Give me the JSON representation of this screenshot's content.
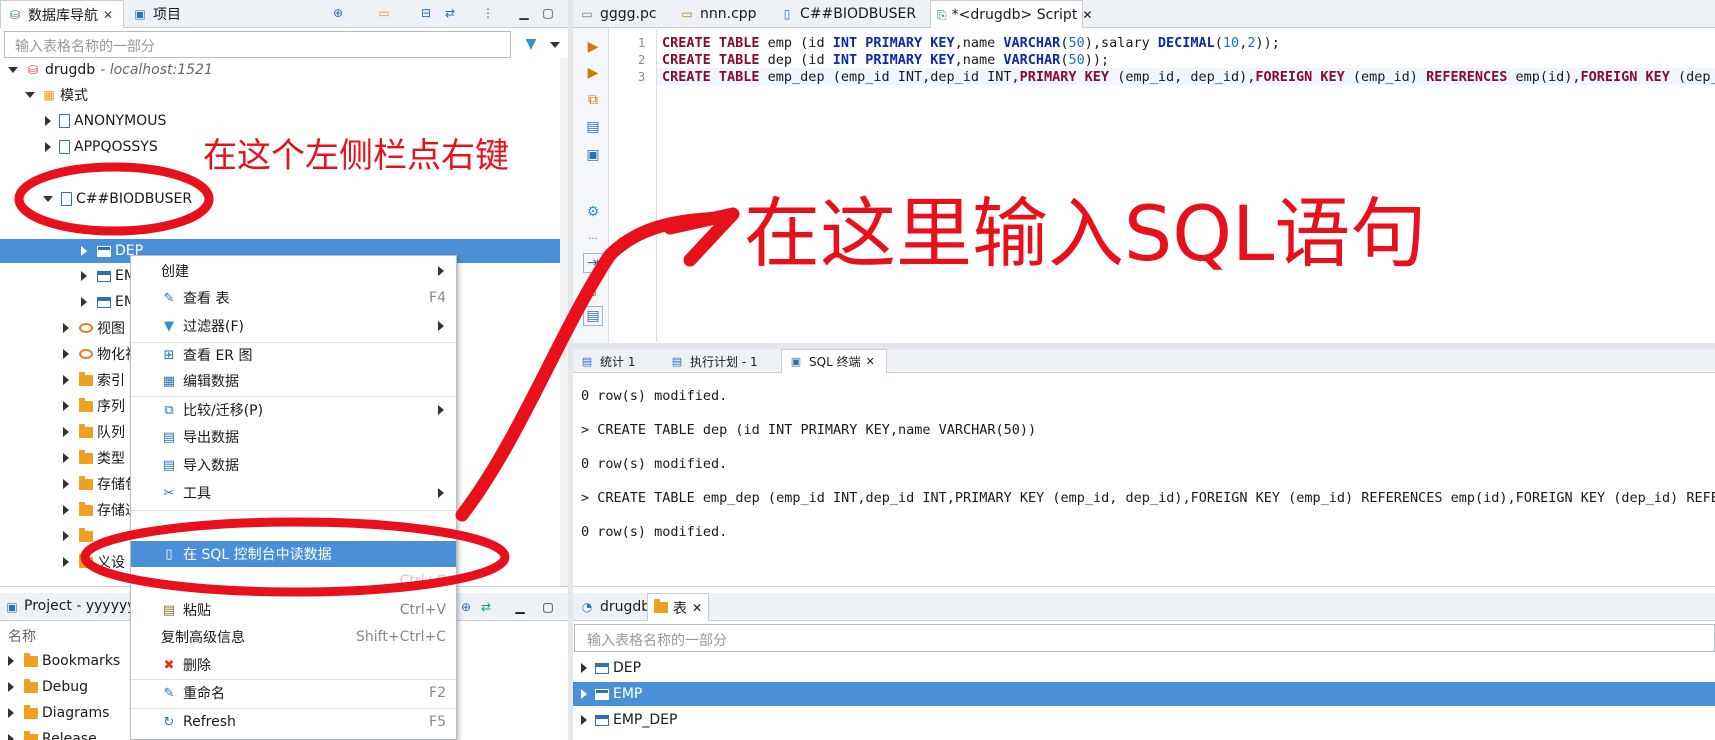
{
  "left_panel": {
    "tabs": [
      {
        "label": "数据库导航"
      },
      {
        "label": "项目"
      }
    ],
    "search_placeholder": "输入表格名称的一部分",
    "connection": {
      "name": "drugdb",
      "host": "- localhost:1521"
    },
    "schemas_node": "模式",
    "tree": {
      "schema1": "ANONYMOUS",
      "schema2": "APPQOSSYS",
      "schema3": "C##BIODBUSER",
      "table1": "DEP",
      "table2": "EMP",
      "table3": "EMP",
      "views": "视图",
      "mviews": "物化视",
      "indexes": "索引",
      "sequences": "序列",
      "queues": "队列",
      "types": "类型",
      "procs1": "存储包",
      "procs2": "存储过",
      "last1": "",
      "last2": "义设"
    }
  },
  "context_menu": {
    "items": {
      "create": "创建",
      "view_table": "查看 表",
      "view_table_sc": "F4",
      "filter": "过滤器(F)",
      "view_er": "查看 ER 图",
      "edit_data": "编辑数据",
      "compare": "比较/迁移(P)",
      "export": "导出数据",
      "import": "导入数据",
      "tools": "工具",
      "read_sql": "在 SQL 控制台中读数据",
      "hidden_sc": "Ctrl+C",
      "paste": "粘贴",
      "paste_sc": "Ctrl+V",
      "copy_adv": "复制高级信息",
      "copy_adv_sc": "Shift+Ctrl+C",
      "delete": "删除",
      "rename": "重命名",
      "rename_sc": "F2",
      "refresh": "Refresh",
      "refresh_sc": "F5"
    }
  },
  "project_panel": {
    "title": "Project - yyyyyyy",
    "col_name": "名称",
    "items": [
      "Bookmarks",
      "Debug",
      "Diagrams",
      "Release"
    ]
  },
  "editor": {
    "tabs": [
      {
        "label": "gggg.pc"
      },
      {
        "label": "nnn.cpp"
      },
      {
        "label": "C##BIODBUSER"
      },
      {
        "label": "*<drugdb> Script"
      }
    ],
    "lines": [
      [
        [
          "kw",
          "CREATE TABLE "
        ],
        [
          "",
          "emp (id "
        ],
        [
          "ty",
          "INT PRIMARY KEY"
        ],
        [
          "",
          ",name "
        ],
        [
          "ty",
          "VARCHAR"
        ],
        [
          "",
          "("
        ],
        [
          "nm",
          "50"
        ],
        [
          "",
          "),salary "
        ],
        [
          "ty",
          "DECIMAL"
        ],
        [
          "",
          "("
        ],
        [
          "nm",
          "10"
        ],
        [
          "",
          ","
        ],
        [
          "nm",
          "2"
        ],
        [
          "",
          "));"
        ]
      ],
      [
        [
          "kw",
          "CREATE TABLE "
        ],
        [
          "",
          "dep (id "
        ],
        [
          "ty",
          "INT PRIMARY KEY"
        ],
        [
          "",
          ",name "
        ],
        [
          "ty",
          "VARCHAR"
        ],
        [
          "",
          "("
        ],
        [
          "nm",
          "50"
        ],
        [
          "",
          "));"
        ]
      ],
      [
        [
          "kw",
          "CREATE TABLE "
        ],
        [
          "",
          "emp_dep (emp_id INT,dep_id INT,"
        ],
        [
          "kw",
          "PRIMARY KEY "
        ],
        [
          "",
          "(emp_id, dep_id),"
        ],
        [
          "kw",
          "FOREIGN KEY "
        ],
        [
          "",
          "(emp_id) "
        ],
        [
          "kw",
          "REFERENCES "
        ],
        [
          "",
          "emp(id),"
        ],
        [
          "kw",
          "FOREIGN KEY "
        ],
        [
          "",
          "(dep_id"
        ]
      ]
    ]
  },
  "results": {
    "tabs": [
      {
        "label": "统计 1"
      },
      {
        "label": "执行计划 - 1"
      },
      {
        "label": "SQL 终端"
      }
    ],
    "output": [
      "0 row(s) modified.",
      "> CREATE TABLE dep (id INT PRIMARY KEY,name VARCHAR(50))",
      "0 row(s) modified.",
      "> CREATE TABLE emp_dep (emp_id INT,dep_id INT,PRIMARY KEY (emp_id, dep_id),FOREIGN KEY (emp_id) REFERENCES emp(id),FOREIGN KEY (dep_id) REFERE",
      "0 row(s) modified."
    ]
  },
  "bottom_right": {
    "tabs": [
      {
        "label": "drugdb"
      },
      {
        "label": "表"
      }
    ],
    "search_placeholder": "输入表格名称的一部分",
    "tables": [
      "DEP",
      "EMP",
      "EMP_DEP"
    ]
  },
  "annotations": {
    "left_text": "在这个左侧栏点右键",
    "right_text": "在这里输入SQL语句"
  },
  "colors": {
    "selection": "#4a90d9",
    "annotation_red": "#e8101b"
  }
}
